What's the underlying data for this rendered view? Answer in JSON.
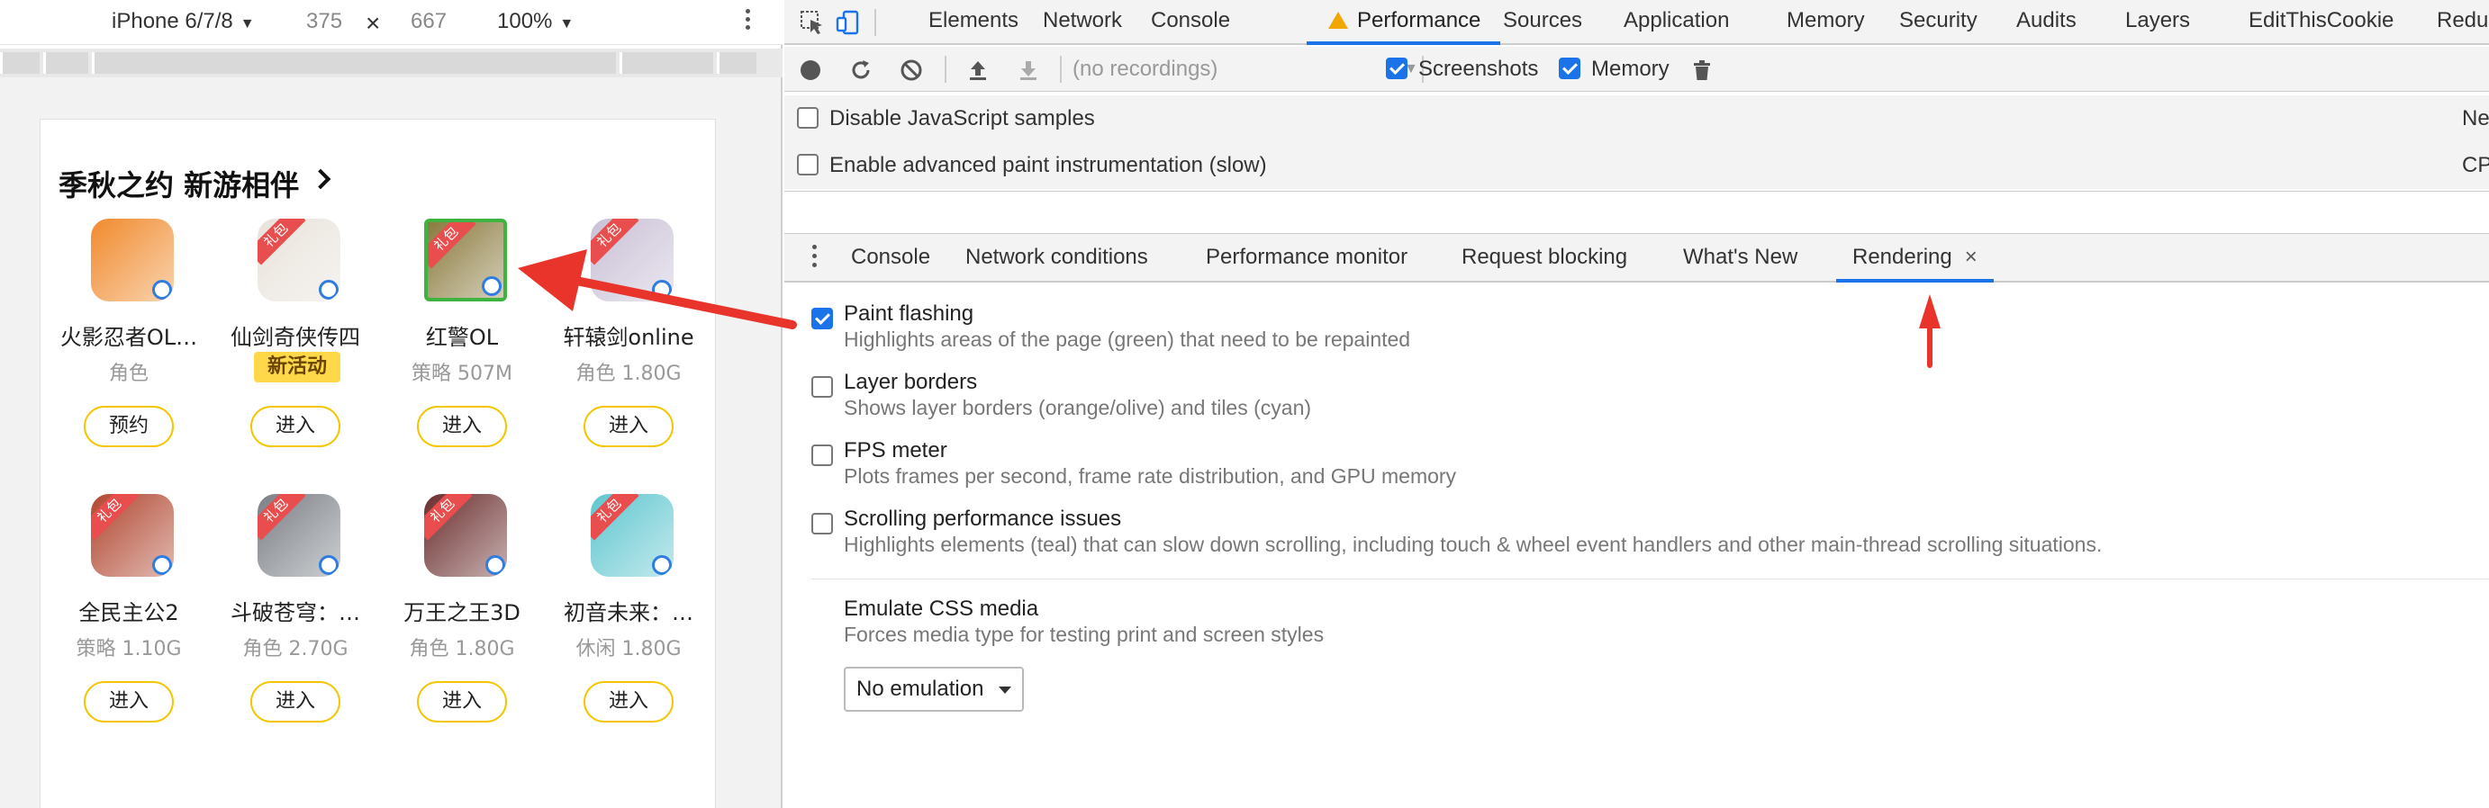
{
  "device_toolbar": {
    "device": "iPhone 6/7/8",
    "width": "375",
    "times": "×",
    "height": "667",
    "zoom": "100%"
  },
  "page": {
    "section_title": "季秋之约 新游相伴",
    "gift_label": "礼包",
    "games": [
      {
        "name": "火影忍者OL…",
        "meta": "角色",
        "button": "预约",
        "icon_color": "#f08a2c",
        "gift": false
      },
      {
        "name": "仙剑奇侠传四",
        "meta": "新活动",
        "button": "进入",
        "icon_color": "#e8e2da",
        "gift": true
      },
      {
        "name": "红警OL",
        "meta": "策略 507M",
        "button": "进入",
        "icon_color": "#8a7a3e",
        "gift": true
      },
      {
        "name": "轩辕剑online",
        "meta": "角色 1.80G",
        "button": "进入",
        "icon_color": "#c9c0d6",
        "gift": true
      },
      {
        "name": "全民主公2",
        "meta": "策略 1.10G",
        "button": "进入",
        "icon_color": "#b0462f",
        "gift": true
      },
      {
        "name": "斗破苍穹：…",
        "meta": "角色 2.70G",
        "button": "进入",
        "icon_color": "#7a7f86",
        "gift": true
      },
      {
        "name": "万王之王3D",
        "meta": "角色 1.80G",
        "button": "进入",
        "icon_color": "#6a2d2d",
        "gift": true
      },
      {
        "name": "初音未来：…",
        "meta": "休闲 1.80G",
        "button": "进入",
        "icon_color": "#5fc6cf",
        "gift": true
      }
    ]
  },
  "devtools": {
    "main_tabs": [
      "Elements",
      "Network",
      "Console",
      "Performance",
      "Sources",
      "Application",
      "Memory",
      "Security",
      "Audits",
      "Layers",
      "EditThisCookie",
      "Redu"
    ],
    "active_tab": "Performance",
    "recordings": "(no recordings)",
    "screenshots_label": "Screenshots",
    "memory_label": "Memory",
    "disable_js_samples": "Disable JavaScript samples",
    "network_right": "Ne",
    "advanced_paint": "Enable advanced paint instrumentation (slow)",
    "cpu_right": "CP",
    "drawer_tabs": [
      "Console",
      "Network conditions",
      "Performance monitor",
      "Request blocking",
      "What's New",
      "Rendering"
    ],
    "drawer_close": "×",
    "rendering": {
      "paint_flashing": {
        "title": "Paint flashing",
        "desc": "Highlights areas of the page (green) that need to be repainted",
        "checked": true
      },
      "layer_borders": {
        "title": "Layer borders",
        "desc": "Shows layer borders (orange/olive) and tiles (cyan)",
        "checked": false
      },
      "fps_meter": {
        "title": "FPS meter",
        "desc": "Plots frames per second, frame rate distribution, and GPU memory",
        "checked": false
      },
      "scroll_perf": {
        "title": "Scrolling performance issues",
        "desc": "Highlights elements (teal) that can slow down scrolling, including touch & wheel event handlers and other main-thread scrolling situations.",
        "checked": false
      },
      "emulate_css_media": {
        "title": "Emulate CSS media",
        "desc": "Forces media type for testing print and screen styles",
        "select_value": "No emulation"
      }
    }
  },
  "colors": {
    "accent": "#1a73e8",
    "annotation_arrow": "#e8342a",
    "paint_flash_green": "#3fb33f",
    "button_border": "#f4c600"
  }
}
